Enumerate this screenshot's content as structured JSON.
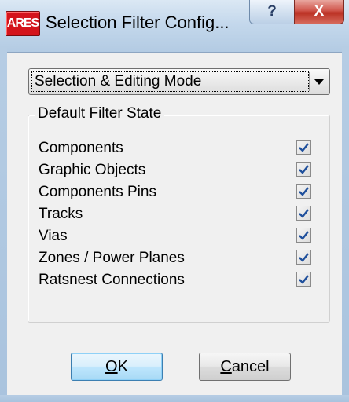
{
  "window": {
    "app_icon_text": "ARES",
    "title": "Selection Filter Config...",
    "help_label": "?",
    "close_label": "X"
  },
  "mode_select": {
    "value": "Selection & Editing Mode"
  },
  "filter_group": {
    "title": "Default Filter State",
    "items": [
      {
        "label": "Components",
        "checked": true
      },
      {
        "label": "Graphic Objects",
        "checked": true
      },
      {
        "label": "Components Pins",
        "checked": true
      },
      {
        "label": "Tracks",
        "checked": true
      },
      {
        "label": "Vias",
        "checked": true
      },
      {
        "label": "Zones / Power Planes",
        "checked": true
      },
      {
        "label": "Ratsnest Connections",
        "checked": true
      }
    ]
  },
  "buttons": {
    "ok_mnemonic": "O",
    "ok_rest": "K",
    "cancel_mnemonic": "C",
    "cancel_rest": "ancel"
  },
  "colors": {
    "check_mark": "#1e4f9c",
    "ok_border": "#3c7fb1",
    "close_red": "#c8473c"
  }
}
